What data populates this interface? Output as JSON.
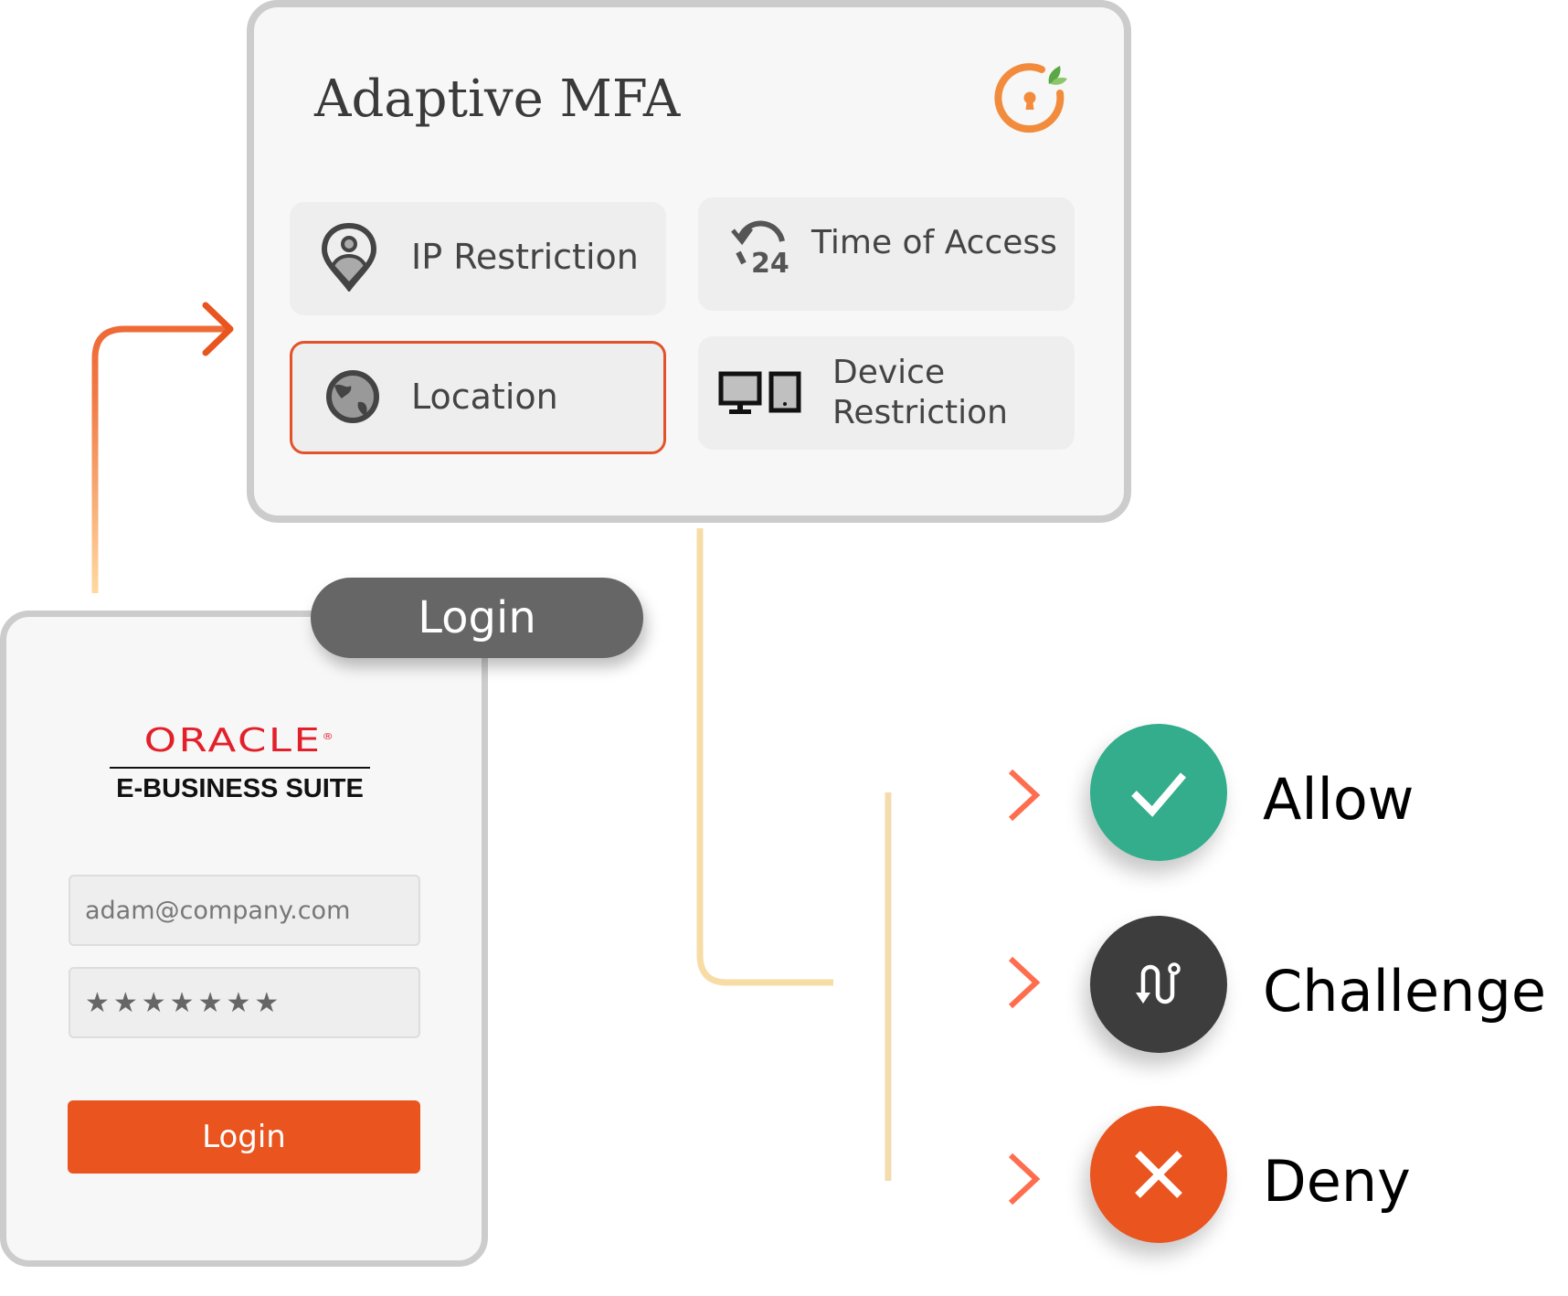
{
  "mfa": {
    "title": "Adaptive MFA",
    "logo_icon": "keyhole-logo-icon",
    "factors": [
      {
        "label": "IP Restriction",
        "icon": "map-pin-user-icon",
        "selected": false
      },
      {
        "label": "Time of Access",
        "icon": "clock-24h-icon",
        "selected": false
      },
      {
        "label": "Location",
        "icon": "globe-icon",
        "selected": true
      },
      {
        "label_line1": "Device",
        "label_line2": "Restriction",
        "icon": "devices-icon",
        "selected": false
      }
    ]
  },
  "login": {
    "pill_label": "Login",
    "brand": "ORACLE",
    "brand_mark": "®",
    "product": "E-BUSINESS SUITE",
    "email_value": "adam@company.com",
    "password_mask": "★★★★★★★",
    "button_label": "Login"
  },
  "outcomes": [
    {
      "label": "Allow",
      "icon": "check-icon",
      "color": "#33ad8c"
    },
    {
      "label": "Challenge",
      "icon": "route-challenge-icon",
      "color": "#3d3d3d"
    },
    {
      "label": "Deny",
      "icon": "x-icon",
      "color": "#e9541f"
    }
  ],
  "colors": {
    "accent": "#e9541f",
    "selected_border": "#e2532b",
    "connector_start": "#ffd9a0",
    "connector_end": "#ff6a4d"
  }
}
